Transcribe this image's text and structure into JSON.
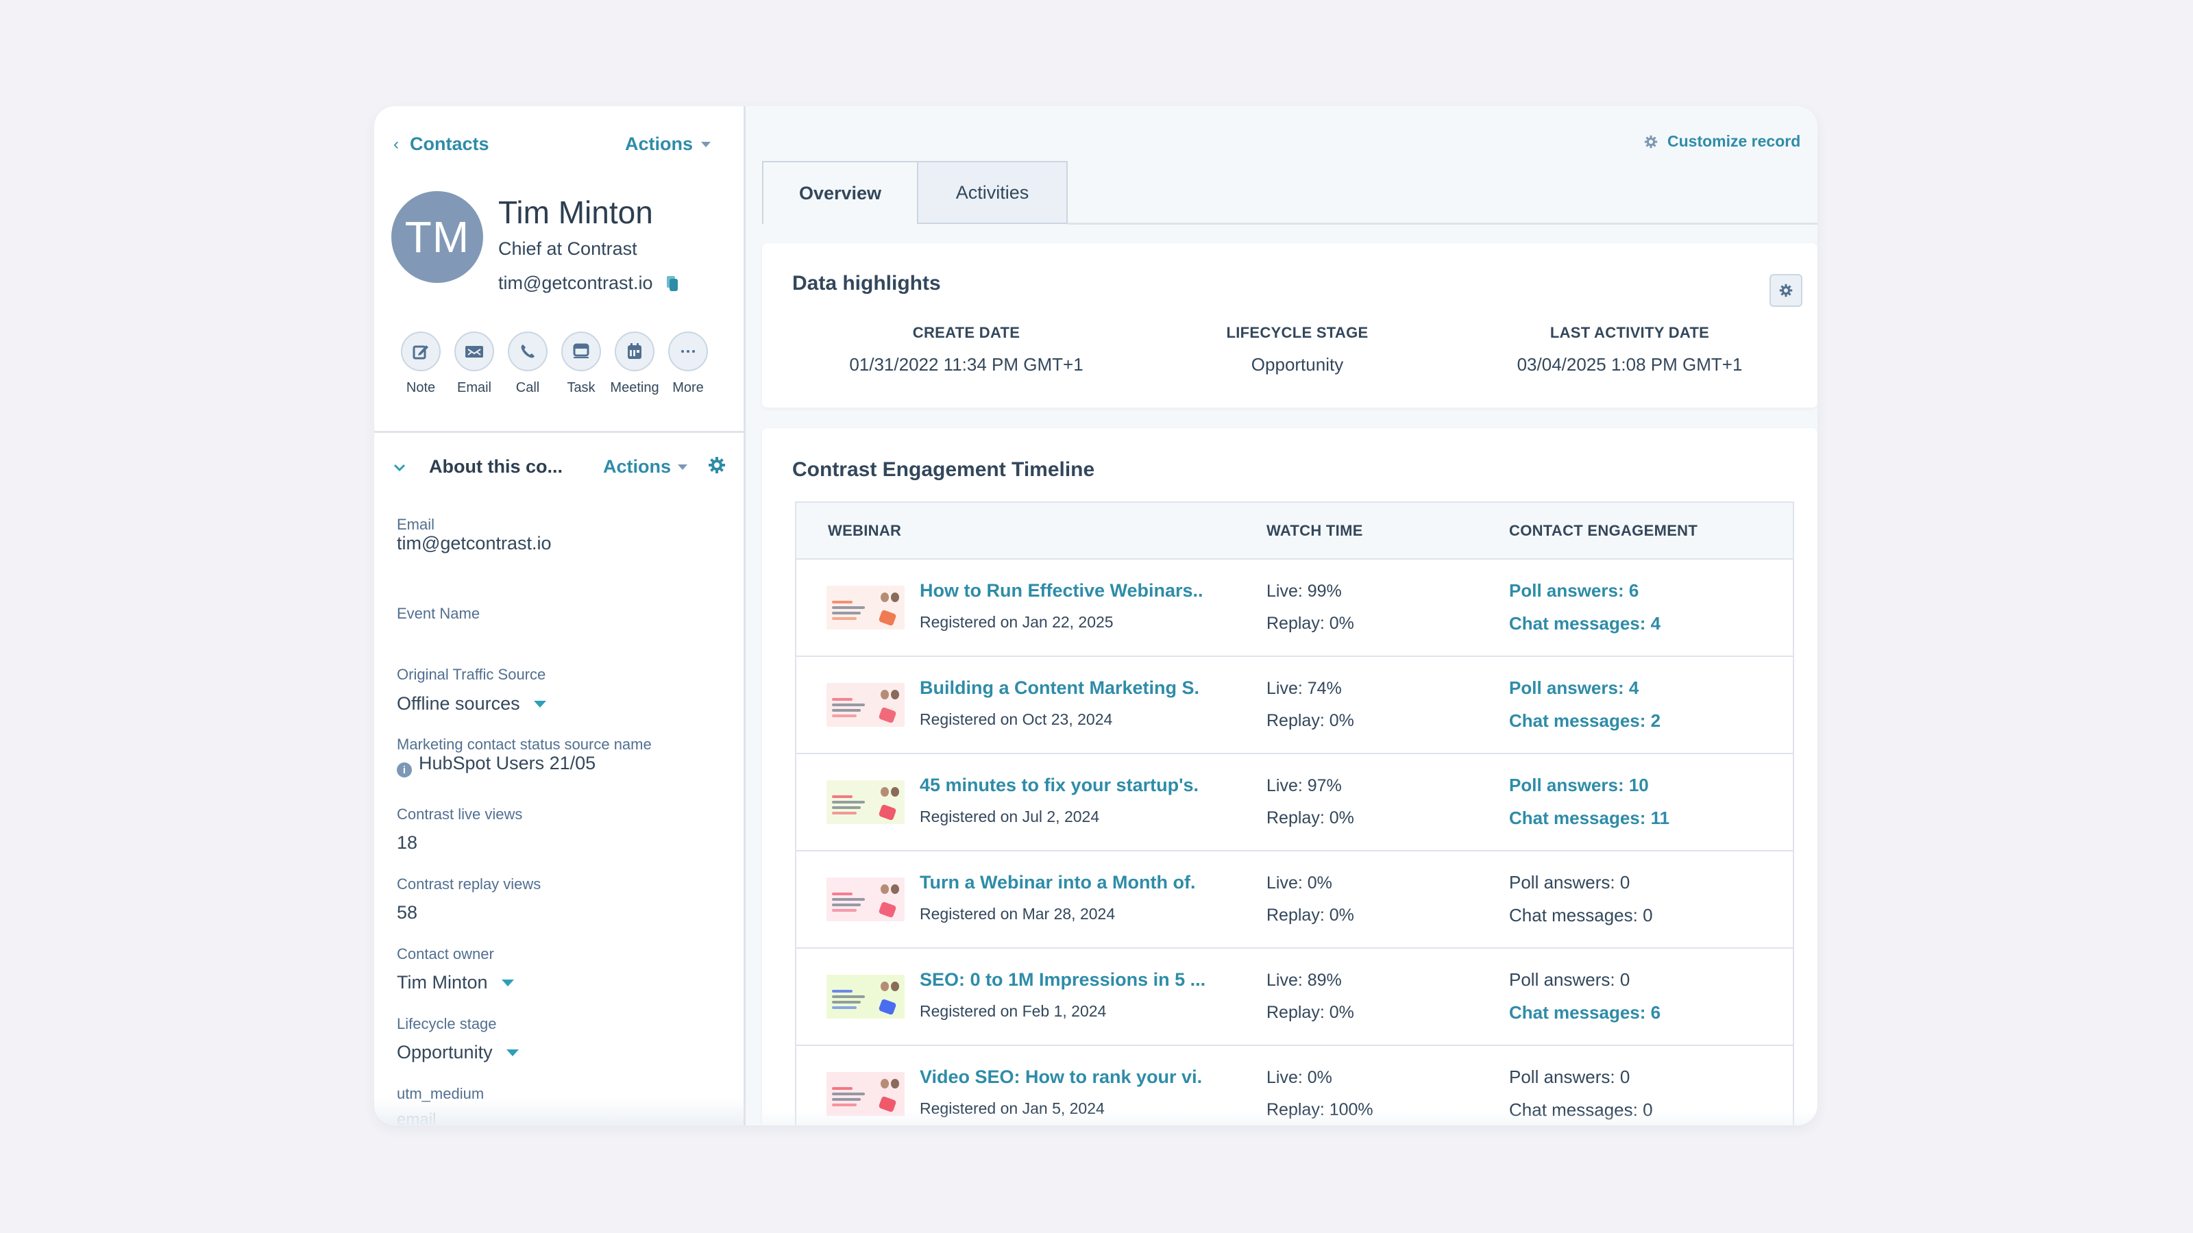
{
  "colors": {
    "page_bg": "#f2f2f7",
    "accent": "#2e8ca8",
    "text": "#33475b",
    "avatar_bg": "#8199b6",
    "border": "#dfe3eb"
  },
  "sidebar": {
    "back_link": {
      "icon": "chevron-left-icon",
      "label": "Contacts"
    },
    "actions_label": "Actions",
    "contact": {
      "initials": "TM",
      "name": "Tim Minton",
      "title": "Chief at Contrast",
      "email": "tim@getcontrast.io"
    },
    "quick_actions": [
      {
        "icon": "note-icon",
        "label": "Note"
      },
      {
        "icon": "email-icon",
        "label": "Email"
      },
      {
        "icon": "phone-icon",
        "label": "Call"
      },
      {
        "icon": "task-icon",
        "label": "Task"
      },
      {
        "icon": "calendar-icon",
        "label": "Meeting"
      },
      {
        "icon": "more-icon",
        "label": "More"
      }
    ],
    "about": {
      "title": "About this co...",
      "actions_label": "Actions",
      "fields": [
        {
          "label": "Email",
          "value": "tim@getcontrast.io"
        },
        {
          "label": "Event Name",
          "value": ""
        },
        {
          "label": "Original Traffic Source",
          "value": "Offline sources"
        },
        {
          "label": "Marketing contact status source name",
          "value": "HubSpot Users 21/05"
        },
        {
          "label": "Contrast live views",
          "value": "18"
        },
        {
          "label": "Contrast replay views",
          "value": "58"
        },
        {
          "label": "Contact owner",
          "value": "Tim Minton"
        },
        {
          "label": "Lifecycle stage",
          "value": "Opportunity"
        },
        {
          "label": "utm_medium",
          "placeholder": "email"
        }
      ]
    }
  },
  "main": {
    "customize_label": "Customize record",
    "tabs": [
      {
        "label": "Overview",
        "active": true
      },
      {
        "label": "Activities",
        "active": false
      }
    ],
    "data_highlights": {
      "title": "Data highlights",
      "items": [
        {
          "label": "CREATE DATE",
          "value": "01/31/2022 11:34 PM GMT+1"
        },
        {
          "label": "LIFECYCLE STAGE",
          "value": "Opportunity"
        },
        {
          "label": "LAST ACTIVITY DATE",
          "value": "03/04/2025 1:08 PM GMT+1"
        }
      ]
    },
    "timeline": {
      "title": "Contrast Engagement Timeline",
      "columns": [
        "WEBINAR",
        "WATCH TIME",
        "CONTACT ENGAGEMENT"
      ],
      "rows": [
        {
          "title": "How to Run Effective Webinars..",
          "registered": "Registered on Jan 22, 2025",
          "live": "Live: 99%",
          "replay": "Replay: 0%",
          "poll": "Poll answers: 6",
          "poll_link": true,
          "chat": "Chat messages: 4",
          "chat_link": true,
          "thumb_bg": "#fdf0ec",
          "thumb_accent": "#f07a52"
        },
        {
          "title": "Building a Content Marketing S.",
          "registered": "Registered on Oct 23, 2024",
          "live": "Live: 74%",
          "replay": "Replay: 0%",
          "poll": "Poll answers: 4",
          "poll_link": true,
          "chat": "Chat messages: 2",
          "chat_link": true,
          "thumb_bg": "#fdecec",
          "thumb_accent": "#f06a7a"
        },
        {
          "title": "45 minutes to fix your startup's.",
          "registered": "Registered on Jul 2, 2024",
          "live": "Live: 97%",
          "replay": "Replay: 0%",
          "poll": "Poll answers: 10",
          "poll_link": true,
          "chat": "Chat messages: 11",
          "chat_link": true,
          "thumb_bg": "#f3f9e0",
          "thumb_accent": "#ef5a6a"
        },
        {
          "title": "Turn a Webinar into a Month of.",
          "registered": "Registered on Mar 28, 2024",
          "live": "Live: 0%",
          "replay": "Replay: 0%",
          "poll": "Poll answers: 0",
          "poll_link": false,
          "chat": "Chat messages: 0",
          "chat_link": false,
          "thumb_bg": "#fdebef",
          "thumb_accent": "#f2627a"
        },
        {
          "title": "SEO: 0 to 1M Impressions in 5 ...",
          "registered": "Registered on Feb 1, 2024",
          "live": "Live: 89%",
          "replay": "Replay: 0%",
          "poll": "Poll answers: 0",
          "poll_link": false,
          "chat": "Chat messages: 6",
          "chat_link": true,
          "thumb_bg": "#eefad6",
          "thumb_accent": "#4a6cf0"
        },
        {
          "title": "Video SEO: How to rank your vi.",
          "registered": "Registered on Jan 5, 2024",
          "live": "Live: 0%",
          "replay": "Replay: 100%",
          "poll": "Poll answers: 0",
          "poll_link": false,
          "chat": "Chat messages: 0",
          "chat_link": false,
          "thumb_bg": "#fde8ec",
          "thumb_accent": "#ef5a6a"
        }
      ]
    }
  }
}
